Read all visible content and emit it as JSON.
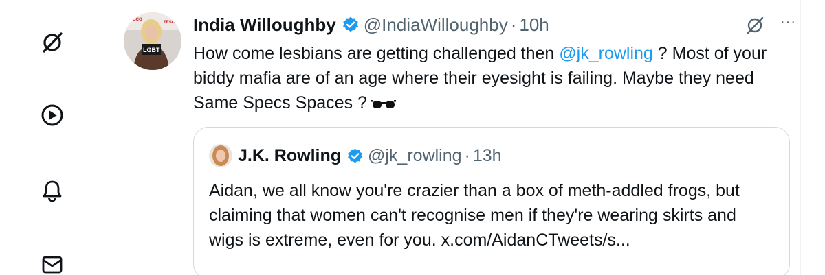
{
  "nav": {
    "items": [
      {
        "icon": "grok-icon",
        "label": ""
      },
      {
        "icon": "play-circle-icon",
        "label": ""
      },
      {
        "icon": "bell-icon",
        "label": ""
      },
      {
        "icon": "mail-icon",
        "label": ""
      }
    ]
  },
  "tweet": {
    "author_name": "India Willoughby",
    "handle": "@IndiaWilloughby",
    "separator": "·",
    "time": "10h",
    "more_label": "···",
    "text_part1": "How come lesbians are getting challenged then ",
    "mention": "@jk_rowling",
    "text_part2": " ? Most of your biddy mafia are of an age where their eyesight is failing. Maybe they need Same Specs Spaces ?",
    "emoji_icon": "glasses-icon",
    "avatar_text": "LGBT",
    "quote": {
      "author_name": "J.K. Rowling",
      "handle": "@jk_rowling",
      "separator": "·",
      "time": "13h",
      "text": "Aidan, we all know you're crazier than a box of meth-addled frogs, but claiming that women can't recognise men if they're wearing skirts and wigs is extreme, even for you. x.com/AidanCTweets/s..."
    }
  },
  "colors": {
    "link": "#1d9bf0",
    "verified": "#1d9bf0",
    "secondary_text": "#536471",
    "border": "#cfd9de"
  }
}
